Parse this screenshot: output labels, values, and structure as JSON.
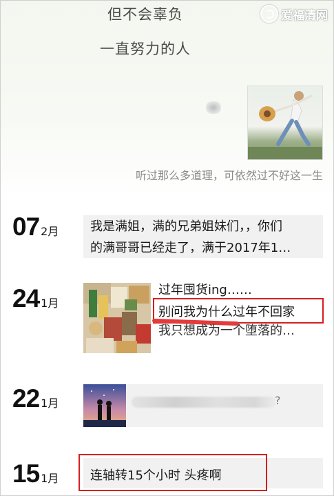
{
  "watermark": {
    "text": "爱福清网",
    "icon": "site-logo-icon"
  },
  "cover": {
    "line1": "但不会辜负",
    "line2": "一直努力的人",
    "signature": "听过那么多道理，可依然过不好这一生"
  },
  "posts": [
    {
      "day": "07",
      "month": "2月",
      "lines": [
        "我是满姐，满的兄弟姐妹们，，你们",
        "的满哥哥已经走了，满于2017年1…"
      ]
    },
    {
      "day": "24",
      "month": "1月",
      "lines": [
        "过年囤货ing……",
        "别问我为什么过年不回家",
        "我只想成为一个堕落的…"
      ]
    },
    {
      "day": "22",
      "month": "1月",
      "lines": [
        "?"
      ]
    },
    {
      "day": "15",
      "month": "1月",
      "lines": [
        "连轴转15个小时  头疼啊"
      ]
    }
  ]
}
